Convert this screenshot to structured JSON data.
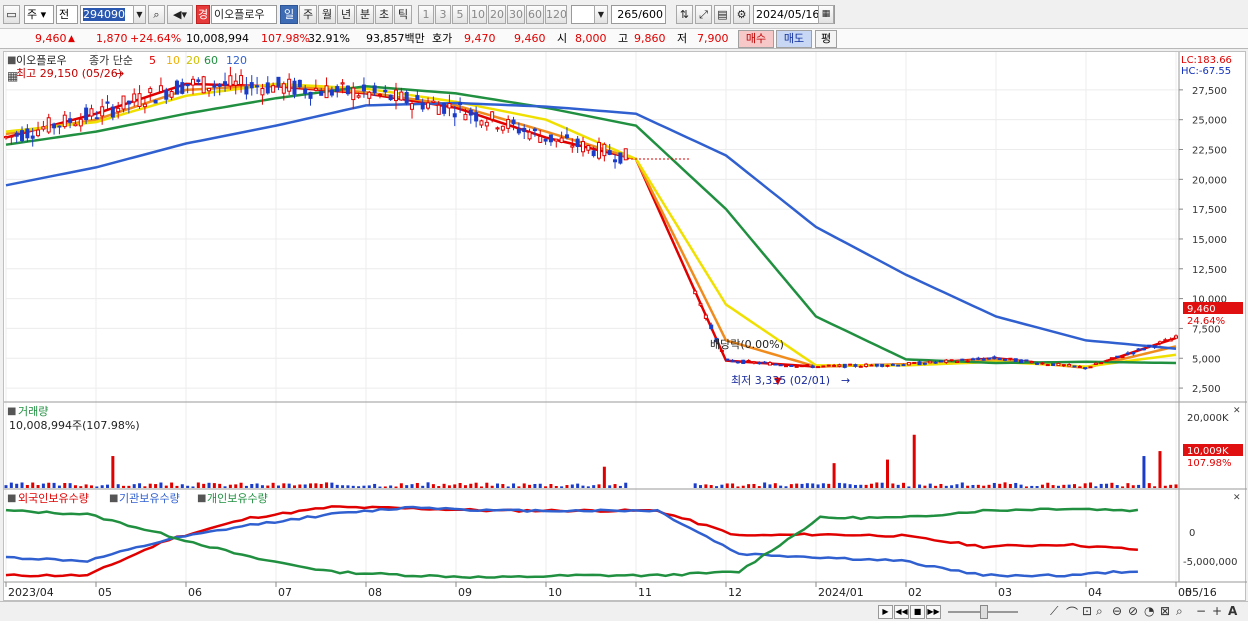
{
  "toolbar": {
    "market_select": "주",
    "prefix_select": "전",
    "code_input": "294090",
    "stock_badge": "경",
    "stock_name": "이오플로우",
    "periods": [
      "일",
      "주",
      "월",
      "년",
      "분",
      "초",
      "틱"
    ],
    "active_period": "일",
    "intervals": [
      "1",
      "3",
      "5",
      "10",
      "20",
      "30",
      "60",
      "120"
    ],
    "count": "265",
    "count_total": "/600",
    "date": "2024/05/16"
  },
  "quote": {
    "price": "9,460",
    "change": "1,870",
    "change_pct": "+24.64%",
    "volume": "10,008,994",
    "volume_ratio": "107.98%",
    "turnover": "32.91%",
    "amount": "93,857백만",
    "ask_label": "호가",
    "ask1": "9,470",
    "ask2": "9,460",
    "open_label": "시",
    "open": "8,000",
    "high_label": "고",
    "high": "9,860",
    "low_label": "저",
    "low": "7,900",
    "buy_button": "매수",
    "sell_button": "매도",
    "eval_button": "평"
  },
  "price_panel": {
    "title": "이오플로우",
    "ma_label": "종가 단순",
    "ma_periods": [
      "5",
      "10",
      "20",
      "60",
      "120"
    ],
    "ma_colors": [
      "#e00000",
      "#f08c1e",
      "#f0e000",
      "#209040",
      "#3060d0"
    ],
    "high_annotation": "최고 29,150 (05/26)",
    "low_annotation": "최저 3,335 (02/01)",
    "dividend_annotation": "배당락(0.00%)",
    "lc": "LC:183.66",
    "hc": "HC:-67.55",
    "y_ticks": [
      "27,500",
      "25,000",
      "22,500",
      "20,000",
      "17,500",
      "15,000",
      "12,500",
      "10,000",
      "7,500",
      "5,000",
      "2,500"
    ],
    "current_price_tag": "9,460",
    "current_pct_tag": "24.64%"
  },
  "volume_panel": {
    "title": "거래량",
    "value_label": "10,008,994주(107.98%)",
    "y_ticks": [
      "20,000K",
      "0"
    ],
    "current_tag": "10,009K",
    "current_pct_tag": "107.98%"
  },
  "holdings_panel": {
    "series": [
      {
        "name": "외국인보유수량",
        "color": "#e00000"
      },
      {
        "name": "기관보유수량",
        "color": "#3060d0"
      },
      {
        "name": "개인보유수량",
        "color": "#209040"
      }
    ],
    "y_ticks": [
      "0",
      "-5,000,000"
    ]
  },
  "x_axis": {
    "labels": [
      "2023/04",
      "05",
      "06",
      "07",
      "08",
      "09",
      "10",
      "11",
      "12",
      "2024/01",
      "02",
      "03",
      "04",
      "05",
      "05/16"
    ]
  },
  "chart_data": {
    "type": "line",
    "title": "이오플로우",
    "x": [
      "2023/04",
      "05",
      "06",
      "07",
      "08",
      "09",
      "10",
      "11",
      "12",
      "2024/01",
      "02",
      "03",
      "04",
      "05"
    ],
    "series": [
      {
        "name": "5",
        "values": [
          23500,
          25500,
          28000,
          27800,
          27200,
          26000,
          23500,
          21700,
          4800,
          4300,
          4500,
          5000,
          4200,
          6700
        ]
      },
      {
        "name": "10",
        "values": [
          23800,
          25000,
          27500,
          27900,
          27300,
          26200,
          24000,
          21700,
          6500,
          4300,
          4500,
          4900,
          4200,
          6000
        ]
      },
      {
        "name": "20",
        "values": [
          24000,
          24800,
          27000,
          28000,
          27600,
          26500,
          25000,
          21700,
          9500,
          4400,
          4400,
          4700,
          4300,
          5300
        ]
      },
      {
        "name": "60",
        "values": [
          22900,
          24000,
          25500,
          26800,
          27800,
          27200,
          26000,
          24500,
          17500,
          8500,
          4900,
          4600,
          4700,
          4600
        ]
      },
      {
        "name": "120",
        "values": [
          19500,
          21000,
          23000,
          24500,
          26200,
          26400,
          26100,
          25500,
          22000,
          16000,
          12000,
          8500,
          6500,
          5800
        ]
      }
    ],
    "xlabel": "",
    "ylabel": "",
    "ylim": [
      1500,
      29500
    ],
    "grid": true
  }
}
